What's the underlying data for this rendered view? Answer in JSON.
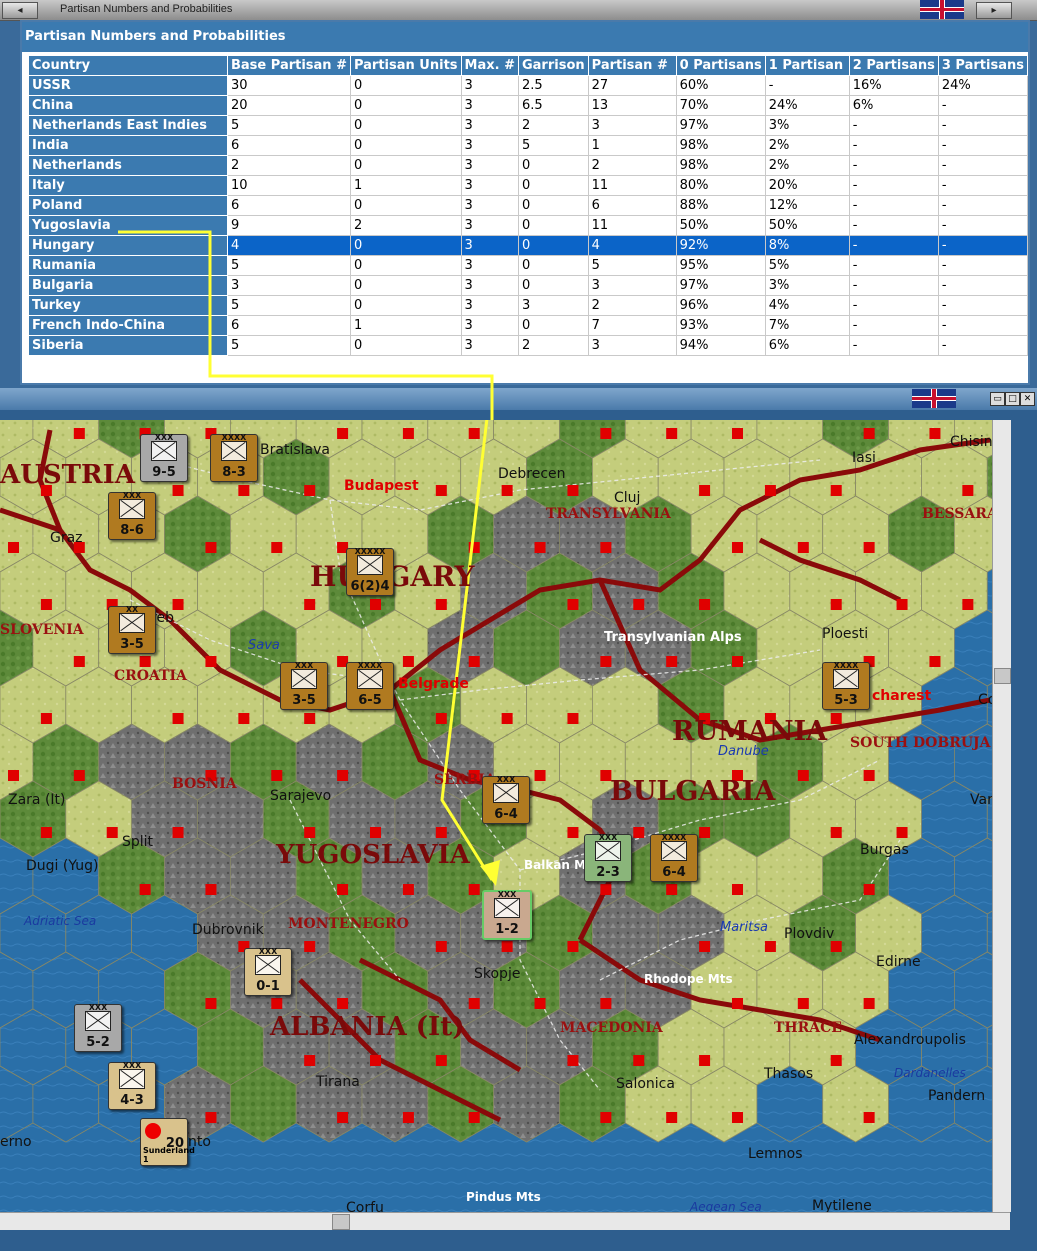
{
  "window": {
    "title": "Partisan Numbers and Probabilities"
  },
  "panel": {
    "title": "Partisan Numbers and Probabilities",
    "columns": [
      "Country",
      "Base Partisan #",
      "Partisan Units",
      "Max. #",
      "Garrison",
      "Partisan #",
      "0 Partisans",
      "1 Partisan",
      "2 Partisans",
      "3 Partisans"
    ],
    "rows": [
      {
        "country": "USSR",
        "base": "30",
        "units": "0",
        "max": "3",
        "garrison": "2.5",
        "partisan": "27",
        "p0": "60%",
        "p1": "-",
        "p2": "16%",
        "p3": "24%"
      },
      {
        "country": "China",
        "base": "20",
        "units": "0",
        "max": "3",
        "garrison": "6.5",
        "partisan": "13",
        "p0": "70%",
        "p1": "24%",
        "p2": "6%",
        "p3": "-"
      },
      {
        "country": "Netherlands East Indies",
        "base": "5",
        "units": "0",
        "max": "3",
        "garrison": "2",
        "partisan": "3",
        "p0": "97%",
        "p1": "3%",
        "p2": "-",
        "p3": "-"
      },
      {
        "country": "India",
        "base": "6",
        "units": "0",
        "max": "3",
        "garrison": "5",
        "partisan": "1",
        "p0": "98%",
        "p1": "2%",
        "p2": "-",
        "p3": "-"
      },
      {
        "country": "Netherlands",
        "base": "2",
        "units": "0",
        "max": "3",
        "garrison": "0",
        "partisan": "2",
        "p0": "98%",
        "p1": "2%",
        "p2": "-",
        "p3": "-"
      },
      {
        "country": "Italy",
        "base": "10",
        "units": "1",
        "max": "3",
        "garrison": "0",
        "partisan": "11",
        "p0": "80%",
        "p1": "20%",
        "p2": "-",
        "p3": "-"
      },
      {
        "country": "Poland",
        "base": "6",
        "units": "0",
        "max": "3",
        "garrison": "0",
        "partisan": "6",
        "p0": "88%",
        "p1": "12%",
        "p2": "-",
        "p3": "-"
      },
      {
        "country": "Yugoslavia",
        "base": "9",
        "units": "2",
        "max": "3",
        "garrison": "0",
        "partisan": "11",
        "p0": "50%",
        "p1": "50%",
        "p2": "-",
        "p3": "-"
      },
      {
        "country": "Hungary",
        "base": "4",
        "units": "0",
        "max": "3",
        "garrison": "0",
        "partisan": "4",
        "p0": "92%",
        "p1": "8%",
        "p2": "-",
        "p3": "-"
      },
      {
        "country": "Rumania",
        "base": "5",
        "units": "0",
        "max": "3",
        "garrison": "0",
        "partisan": "5",
        "p0": "95%",
        "p1": "5%",
        "p2": "-",
        "p3": "-"
      },
      {
        "country": "Bulgaria",
        "base": "3",
        "units": "0",
        "max": "3",
        "garrison": "0",
        "partisan": "3",
        "p0": "97%",
        "p1": "3%",
        "p2": "-",
        "p3": "-"
      },
      {
        "country": "Turkey",
        "base": "5",
        "units": "0",
        "max": "3",
        "garrison": "3",
        "partisan": "2",
        "p0": "96%",
        "p1": "4%",
        "p2": "-",
        "p3": "-"
      },
      {
        "country": "French Indo-China",
        "base": "6",
        "units": "1",
        "max": "3",
        "garrison": "0",
        "partisan": "7",
        "p0": "93%",
        "p1": "7%",
        "p2": "-",
        "p3": "-"
      },
      {
        "country": "Siberia",
        "base": "5",
        "units": "0",
        "max": "3",
        "garrison": "2",
        "partisan": "3",
        "p0": "94%",
        "p1": "6%",
        "p2": "-",
        "p3": "-"
      }
    ],
    "selected_row": "Hungary"
  },
  "map": {
    "countries": [
      "AUSTRIA",
      "HUNGARY",
      "YUGOSLAVIA",
      "RUMANIA",
      "BULGARIA",
      "ALBANIA (It)"
    ],
    "regions": [
      "SLOVENIA",
      "CROATIA",
      "BOSNIA",
      "SERBIA",
      "MONTENEGRO",
      "MACEDONIA",
      "THRACE",
      "TRANSYLVANIA",
      "BESSARA",
      "SOUTH DOBRUJA"
    ],
    "cities": [
      "Bratislava",
      "Budapest",
      "Debrecen",
      "Cluj",
      "Iasi",
      "Chisin",
      "Graz",
      "Zagreb",
      "Belgrade",
      "Ploesti",
      "Bucharest",
      "Sarajevo",
      "Split",
      "Zara (It)",
      "Dugi (Yug)",
      "Dubrovnik",
      "Skopje",
      "Tirana",
      "Salonica",
      "Sofia",
      "Plovdiv",
      "Edirne",
      "Burgas",
      "Varna",
      "Constanta",
      "Alexandroupolis",
      "Thasos",
      "Lemnos",
      "Mytilene",
      "Corfu",
      "Taranto",
      "Salerno",
      "Pandern"
    ],
    "features": [
      "Transylvanian Alps",
      "Balkan Mts",
      "Rhodope Mts",
      "Pindus Mts",
      "Sava",
      "Danube",
      "Maritsa",
      "Adriatic Sea",
      "Aegean Sea",
      "Dardanelles"
    ],
    "units": [
      {
        "id": "u1",
        "value": "9-5",
        "size": "XXX"
      },
      {
        "id": "u2",
        "value": "8-3",
        "size": "XXXX"
      },
      {
        "id": "u3",
        "value": "8-6",
        "size": "XXX"
      },
      {
        "id": "u4",
        "value": "6(2)4",
        "size": "XXXXX"
      },
      {
        "id": "u5",
        "value": "3-5",
        "size": "XX"
      },
      {
        "id": "u6",
        "value": "3-5",
        "size": "XXX"
      },
      {
        "id": "u7",
        "value": "6-5",
        "size": "XXXX"
      },
      {
        "id": "u8",
        "value": "5-3",
        "size": "XXXX"
      },
      {
        "id": "u9",
        "value": "6-4",
        "size": "XXX"
      },
      {
        "id": "u10",
        "value": "2-3",
        "size": "XXX"
      },
      {
        "id": "u11",
        "value": "6-4",
        "size": "XXXX"
      },
      {
        "id": "u12",
        "value": "1-2",
        "size": "XXX"
      },
      {
        "id": "u13",
        "value": "0-1",
        "size": "XXX"
      },
      {
        "id": "u14",
        "value": "5-2",
        "size": "XXX"
      },
      {
        "id": "u15",
        "value": "4-3",
        "size": "XXX"
      }
    ],
    "ship": {
      "name": "Sunderland 1",
      "value": "20"
    },
    "arrow_color": "#ffff33"
  },
  "colors": {
    "header_blue": "#3b7ab0",
    "selected_row": "#0b64c8",
    "border_red": "#8a0a0a",
    "sea": "#2a6fa8"
  }
}
